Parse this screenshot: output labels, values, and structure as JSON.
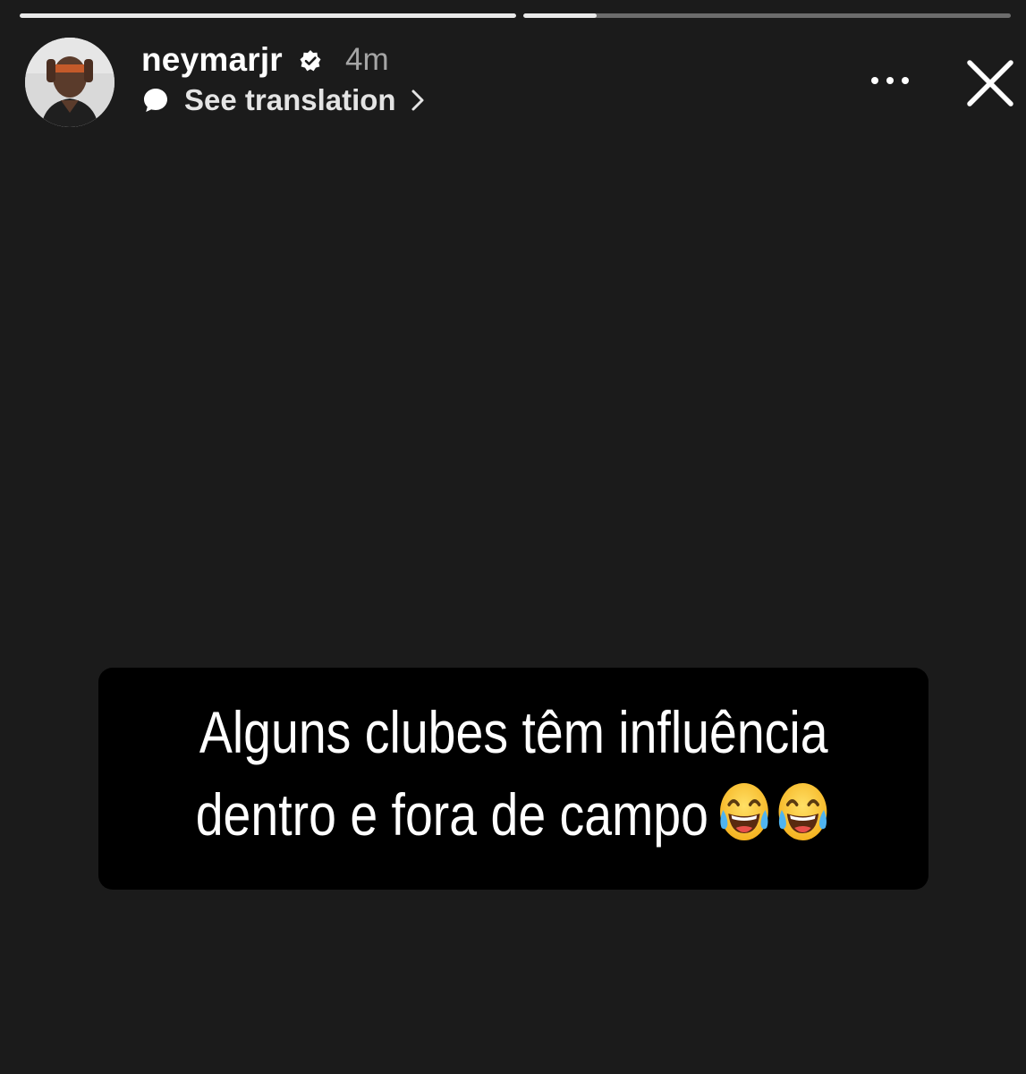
{
  "story": {
    "progress": [
      1.0,
      0.15
    ]
  },
  "header": {
    "username": "neymarjr",
    "verified": true,
    "time_ago": "4m",
    "translation_label": "See translation",
    "icons": {
      "avatar": "profile-photo",
      "verified": "verified-badge-icon",
      "translate": "speech-bubble-icon",
      "chevron": "chevron-right-icon",
      "more": "more-options-icon",
      "close": "close-icon"
    }
  },
  "caption": {
    "line1": "Alguns clubes têm influência",
    "line2": "dentro e fora de campo",
    "emoji": [
      "face-with-tears-of-joy",
      "face-with-tears-of-joy"
    ]
  },
  "colors": {
    "background": "#1b1b1b",
    "caption_box": "#000000",
    "progress_track": "#6c6c6c",
    "progress_fill": "#e9e9e9",
    "secondary_text": "#a5a5a5"
  }
}
